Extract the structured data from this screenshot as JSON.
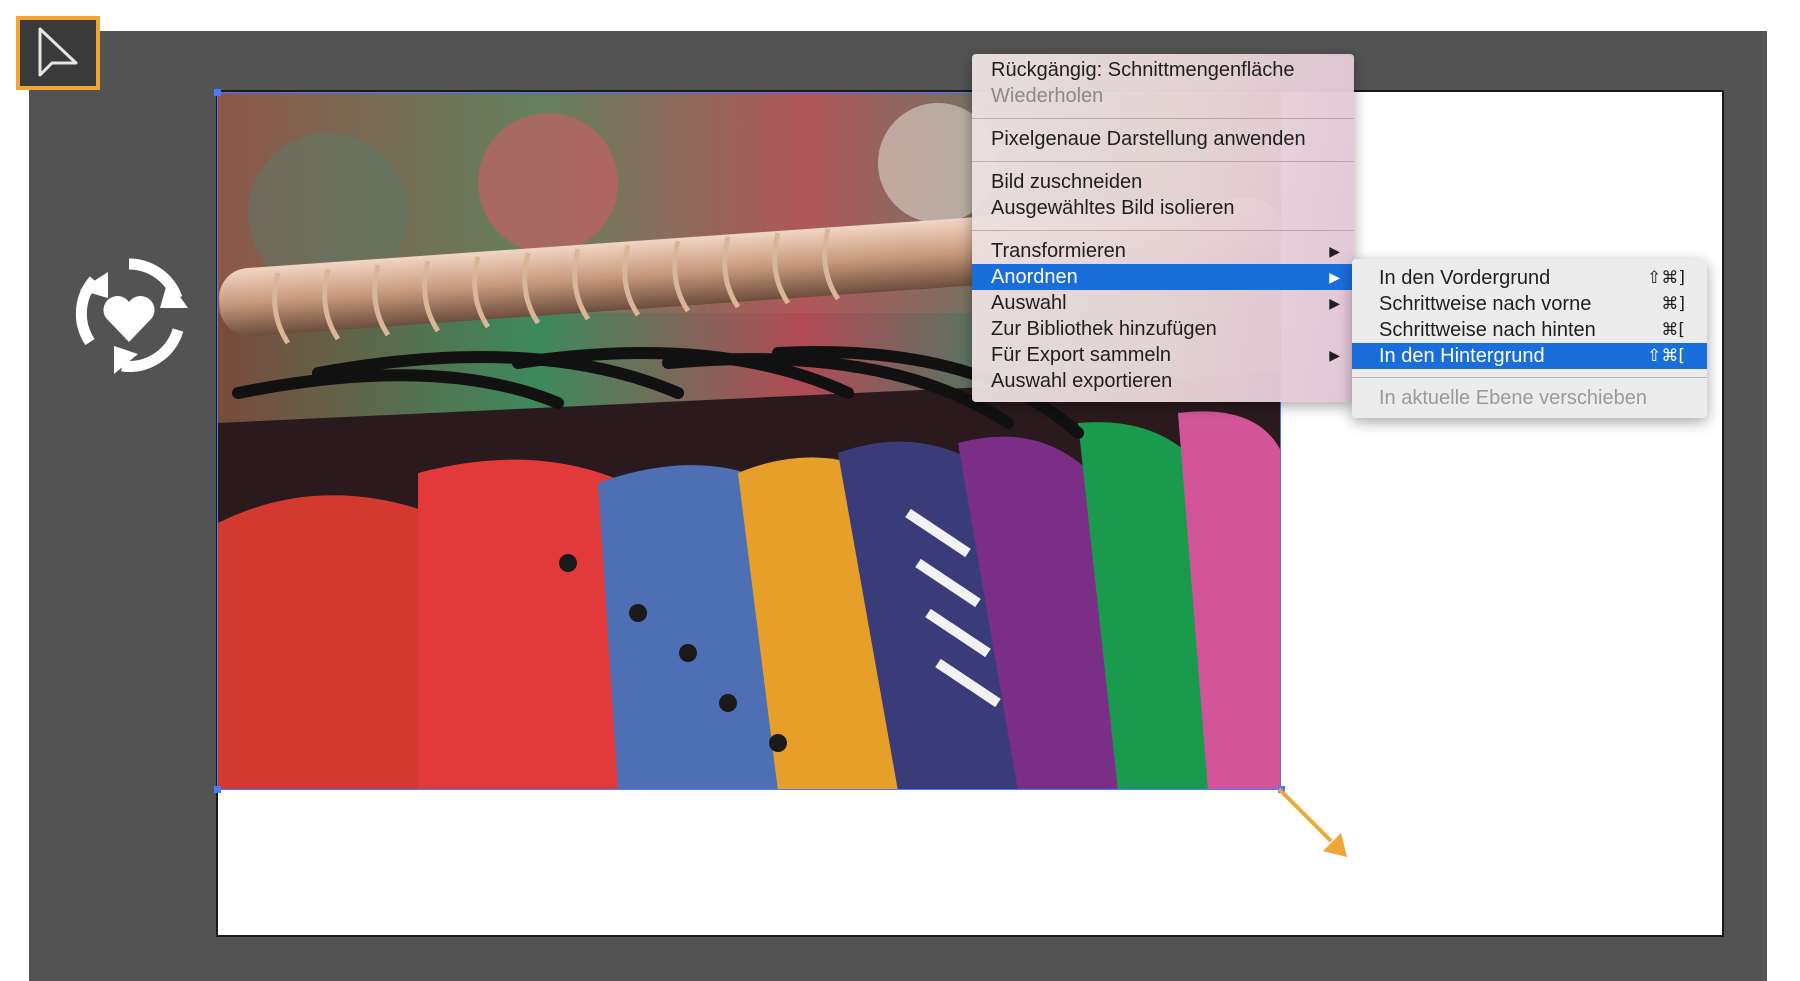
{
  "toolbar": {
    "active_tool_icon": "selection-arrow-icon",
    "accent": "#f0a535"
  },
  "sync_icon": "heart-sync-icon",
  "artboard": {
    "photo_subject": "clothing-rack-photo"
  },
  "context_menu": {
    "items": [
      {
        "label": "Rückgängig: Schnittmengenfläche",
        "disabled": false
      },
      {
        "label": "Wiederholen",
        "disabled": true
      },
      {
        "label": "Pixelgenaue Darstellung anwenden"
      },
      {
        "label": "Bild zuschneiden"
      },
      {
        "label": "Ausgewähltes Bild isolieren"
      },
      {
        "label": "Transformieren",
        "submenu": true
      },
      {
        "label": "Anordnen",
        "submenu": true,
        "active": true
      },
      {
        "label": "Auswahl",
        "submenu": true
      },
      {
        "label": "Zur Bibliothek hinzufügen"
      },
      {
        "label": "Für Export sammeln",
        "submenu": true
      },
      {
        "label": "Auswahl exportieren"
      }
    ]
  },
  "submenu": {
    "items": [
      {
        "label": "In den Vordergrund",
        "shortcut": "⇧⌘]"
      },
      {
        "label": "Schrittweise nach vorne",
        "shortcut": "⌘]"
      },
      {
        "label": "Schrittweise nach hinten",
        "shortcut": "⌘["
      },
      {
        "label": "In den Hintergrund",
        "shortcut": "⇧⌘[",
        "active": true
      },
      {
        "label": "In aktuelle Ebene verschieben",
        "disabled": true
      }
    ]
  },
  "colors": {
    "highlight": "#1a6edb",
    "annotation_arrow": "#f0a535",
    "selection": "#4a7bff"
  }
}
